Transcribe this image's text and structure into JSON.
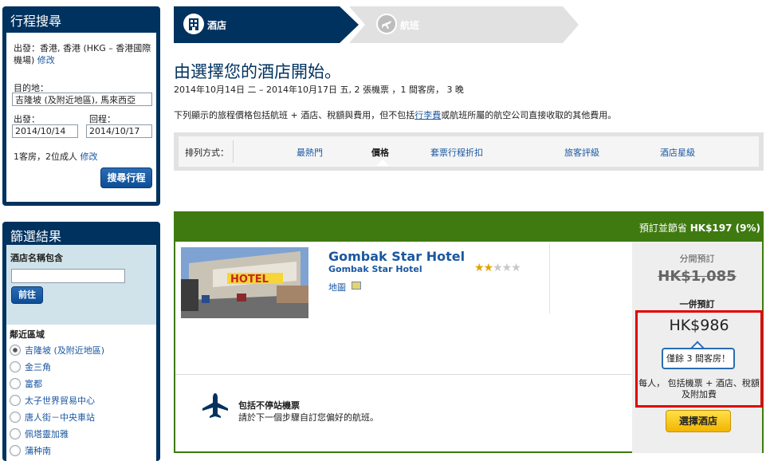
{
  "search": {
    "title": "行程搜尋",
    "from_label": "出發：",
    "from_value": "香港, 香港 (HKG – 香港國際機場)",
    "modify": "修改",
    "dest_label": "目的地：",
    "dest_value": "吉隆坡 (及附近地區), 馬來西亞",
    "depart_label": "出發：",
    "depart_value": "2014/10/14",
    "return_label": "回程：",
    "return_value": "2014/10/17",
    "guests": "1客房，2位成人",
    "guests_modify": "修改",
    "button": "搜尋行程"
  },
  "filter": {
    "title": "篩選結果",
    "name_label": "酒店名稱包含",
    "name_placeholder": "",
    "go_button": "前往",
    "area_label": "鄰近區域",
    "areas": [
      {
        "label": "吉隆坡 (及附近地區)",
        "checked": true
      },
      {
        "label": "金三角",
        "checked": false
      },
      {
        "label": "富都",
        "checked": false
      },
      {
        "label": "太子世界貿易中心",
        "checked": false
      },
      {
        "label": "唐人街－中央車站",
        "checked": false
      },
      {
        "label": "佩塔靈加雅",
        "checked": false
      },
      {
        "label": "蒲种南",
        "checked": false
      }
    ]
  },
  "steps": [
    {
      "label": "酒店",
      "icon": "hotel-building-icon",
      "active": true
    },
    {
      "label": "航班",
      "icon": "airplane-icon",
      "active": false
    }
  ],
  "heading": {
    "title": "由選擇您的酒店開始。",
    "subtitle": "2014年10月14日 二 – 2014年10月17日 五, 2 張機票 ，1 間客房， 3 晚",
    "notice_before": "下列顯示的旅程價格包括航班 + 酒店、稅額與費用，但不包括",
    "notice_link": "行李費",
    "notice_after": "或航班所屬的航空公司直接收取的其他費用。"
  },
  "sort": {
    "label": "排列方式：",
    "options": [
      "最熱門",
      "價格",
      "套票行程折扣",
      "旅客評級",
      "酒店星級"
    ],
    "active": "價格"
  },
  "result": {
    "savings_label": "預訂並節省",
    "savings_value": "HK$197 (9%)",
    "hotel_name": "Gombak Star Hotel",
    "hotel_subname": "Gombak Star Hotel",
    "star_rating": 2,
    "star_max": 5,
    "map_label": "地圖",
    "separate_label": "分開預訂",
    "old_price": "HK$1,085",
    "bundle_label": "一併預訂",
    "price": "HK$986",
    "rooms_left": "僅餘 3 間客房！",
    "per_person_note": "每人， 包括機票 + 酒店、稅額及附加費",
    "select_button": "選擇酒店",
    "flight_title": "包括不停站機票",
    "flight_desc": "請於下一個步驟自訂您偏好的航班。"
  },
  "colors": {
    "brand_navy": "#00325f",
    "card_green": "#3f7a10",
    "link_blue": "#1a57a0",
    "highlight_red": "#e00000",
    "button_yellow": "#f2b500"
  }
}
